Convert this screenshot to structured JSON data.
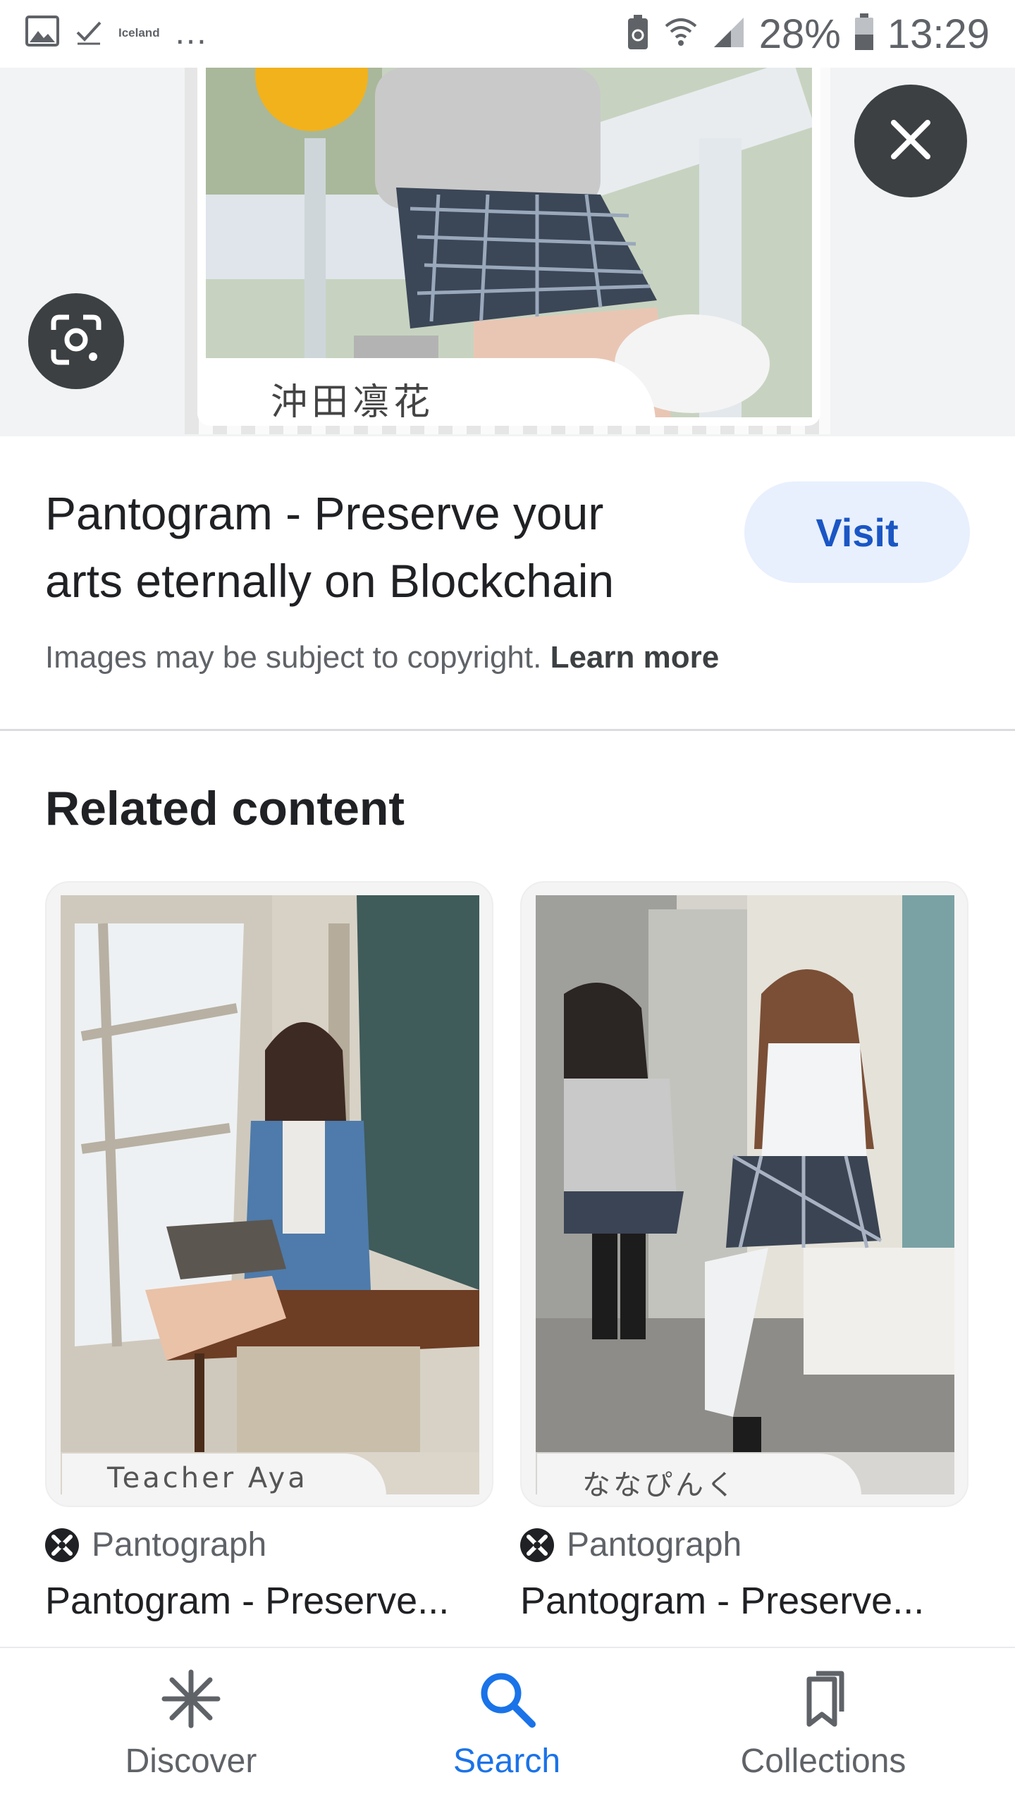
{
  "status_bar": {
    "carrier_label": "Iceland",
    "more": "...",
    "battery": "28%",
    "time": "13:29"
  },
  "preview": {
    "caption": "沖田凛花",
    "close_icon": "close-icon",
    "lens_icon": "google-lens-icon"
  },
  "result": {
    "title": "Pantogram - Preserve your arts eternally on Blockchain",
    "visit_label": "Visit",
    "copyright_text": "Images may be subject to copyright.",
    "learn_more": "Learn more"
  },
  "related": {
    "heading": "Related content",
    "items": [
      {
        "caption": "Teacher Aya",
        "source": "Pantograph",
        "title": "Pantogram - Preserve..."
      },
      {
        "caption": "ななぴんく",
        "source": "Pantograph",
        "title": "Pantogram - Preserve..."
      }
    ]
  },
  "bottom_nav": {
    "items": [
      {
        "label": "Discover",
        "icon": "asterisk-icon",
        "active": false
      },
      {
        "label": "Search",
        "icon": "search-icon",
        "active": true
      },
      {
        "label": "Collections",
        "icon": "bookmarks-icon",
        "active": false
      }
    ]
  },
  "colors": {
    "accent": "#1a73e8",
    "visit_bg": "#e8f0fe",
    "overlay_button": "#3c4043"
  }
}
